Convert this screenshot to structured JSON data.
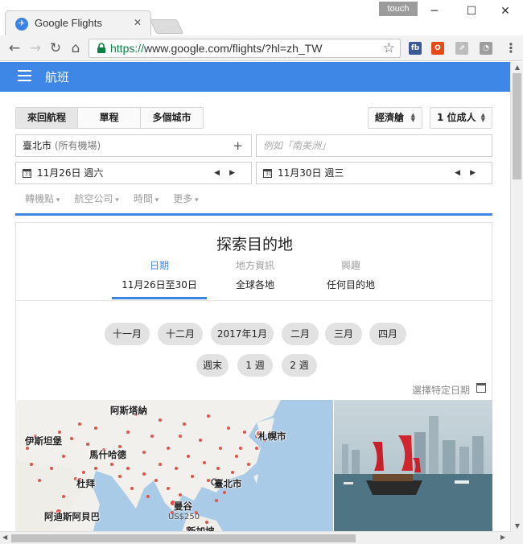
{
  "browser": {
    "tab_title": "Google Flights",
    "tab_close_icon": "close-icon",
    "touch_label": "touch",
    "window_controls": {
      "minimize": "─",
      "maximize": "☐",
      "close": "✕"
    },
    "url_protocol": "https://",
    "url_rest": "www.google.com/flights/?hl=zh_TW",
    "extensions": [
      {
        "name": "facebook-extension-icon",
        "glyph": "fb",
        "color": "#3b5998"
      },
      {
        "name": "office-extension-icon",
        "glyph": "O",
        "color": "#e64a19"
      },
      {
        "name": "share-extension-icon",
        "glyph": "⇗",
        "color": "#bdbdbd"
      },
      {
        "name": "compass-extension-icon",
        "glyph": "◔",
        "color": "#9e9e9e"
      }
    ]
  },
  "appbar": {
    "title": "航班"
  },
  "trip_types": [
    {
      "label": "來回航程",
      "active": true
    },
    {
      "label": "單程",
      "active": false
    },
    {
      "label": "多個城市",
      "active": false
    }
  ],
  "cabin_label": "經濟艙",
  "passengers_label": "1 位成人",
  "origin": {
    "city": "臺北市",
    "detail": "(所有機場)"
  },
  "destination_placeholder": "例如「南美洲」",
  "depart_date": "11月26日 週六",
  "return_date": "11月30日 週三",
  "filters": [
    "轉機點",
    "航空公司",
    "時間",
    "更多"
  ],
  "explore": {
    "title": "探索目的地",
    "categories": [
      {
        "label": "日期",
        "value": "11月26日至30日",
        "active": true
      },
      {
        "label": "地方資訊",
        "value": "全球各地",
        "active": false
      },
      {
        "label": "興趣",
        "value": "任何目的地",
        "active": false
      }
    ],
    "months": [
      "十一月",
      "十二月",
      "2017年1月",
      "二月",
      "三月",
      "四月"
    ],
    "durations": [
      "週末",
      "1 週",
      "2 週"
    ],
    "pick_date_label": "選擇特定日期"
  },
  "map": {
    "labels": {
      "astana": "阿斯塔納",
      "sapporo": "札幌市",
      "istanbul": "伊斯坦堡",
      "mashhad": "馬什哈德",
      "dubai": "杜拜",
      "taipei": "臺北市",
      "addis": "阿迪斯阿貝巴",
      "bangkok": "曼谷",
      "singapore": "新加坡",
      "bangkok_price": "US$250"
    }
  },
  "colors": {
    "accent": "#3f87e6",
    "dot": "#e0544d"
  }
}
